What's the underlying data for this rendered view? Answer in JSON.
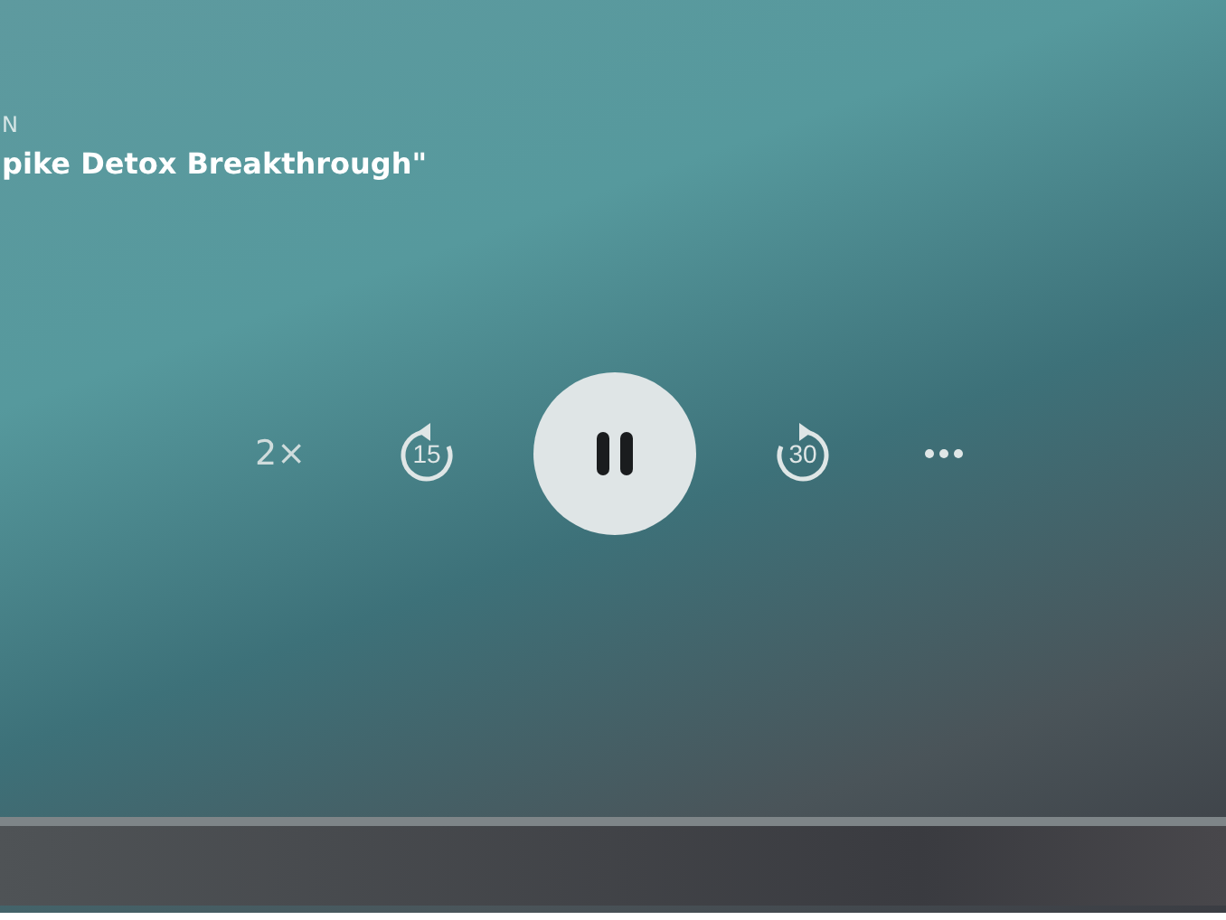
{
  "episode": {
    "show": "N",
    "title": "pike Detox Breakthrough\""
  },
  "controls": {
    "speed": "2×",
    "skip_back": "15",
    "skip_forward": "30",
    "playing": true
  }
}
